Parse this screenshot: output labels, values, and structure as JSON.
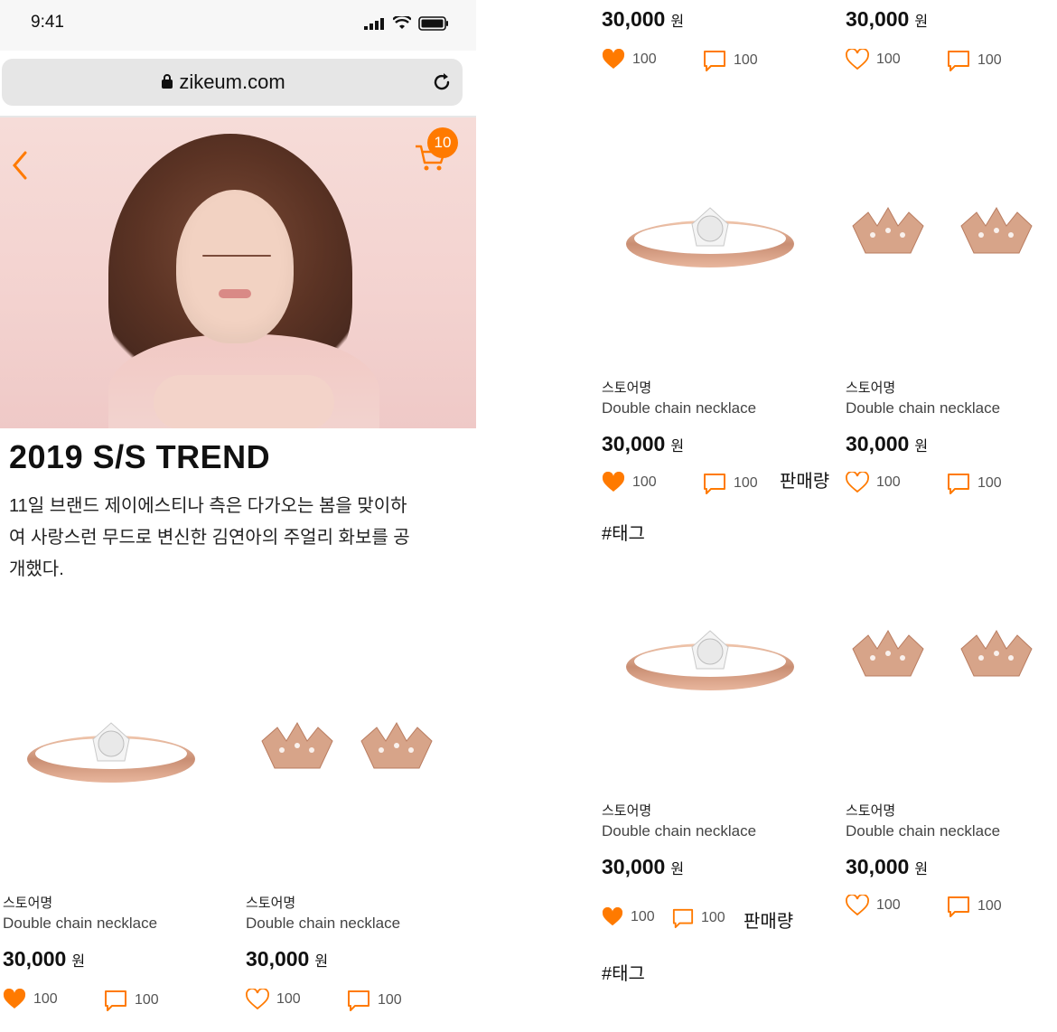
{
  "status": {
    "time": "9:41"
  },
  "browser": {
    "url": "zikeum.com"
  },
  "hero": {
    "cart_count": "10"
  },
  "article": {
    "title": "2019 S/S TREND",
    "desc_lines": [
      "11일 브랜드 제이에스티나 측은 다가오는 봄을 맞이하",
      "여 사랑스런 무드로 변신한 김연아의 주얼리 화보를 공",
      "개했다."
    ]
  },
  "left_products": [
    {
      "store": "스토어명",
      "name": "Double chain necklace",
      "price": "30,000",
      "unit": "원",
      "likes": "100",
      "comments": "100",
      "liked": true,
      "image": "ring"
    },
    {
      "store": "스토어명",
      "name": "Double chain necklace",
      "price": "30,000",
      "unit": "원",
      "likes": "100",
      "comments": "100",
      "liked": false,
      "image": "crowns"
    }
  ],
  "right_top_row": [
    {
      "price": "30,000",
      "unit": "원",
      "likes": "100",
      "comments": "100",
      "liked": true
    },
    {
      "price": "30,000",
      "unit": "원",
      "likes": "100",
      "comments": "100",
      "liked": false
    }
  ],
  "right_products_a": [
    {
      "store": "스토어명",
      "name": "Double chain necklace",
      "price": "30,000",
      "unit": "원",
      "likes": "100",
      "comments": "100",
      "liked": true,
      "image": "ring"
    },
    {
      "store": "스토어명",
      "name": "Double chain necklace",
      "price": "30,000",
      "unit": "원",
      "likes": "100",
      "comments": "100",
      "liked": false,
      "image": "crowns"
    }
  ],
  "right_products_b": [
    {
      "store": "스토어명",
      "name": "Double chain necklace",
      "price": "30,000",
      "unit": "원",
      "likes": "100",
      "comments": "100",
      "liked": true,
      "image": "ring"
    },
    {
      "store": "스토어명",
      "name": "Double chain necklace",
      "price": "30,000",
      "unit": "원",
      "likes": "100",
      "comments": "100",
      "liked": false,
      "image": "crowns"
    }
  ],
  "annotations": {
    "sales_label": "판매량",
    "tag_label": "#태그"
  },
  "colors": {
    "accent": "#ff7a00",
    "heart": "#ff7a00",
    "text": "#222222"
  }
}
